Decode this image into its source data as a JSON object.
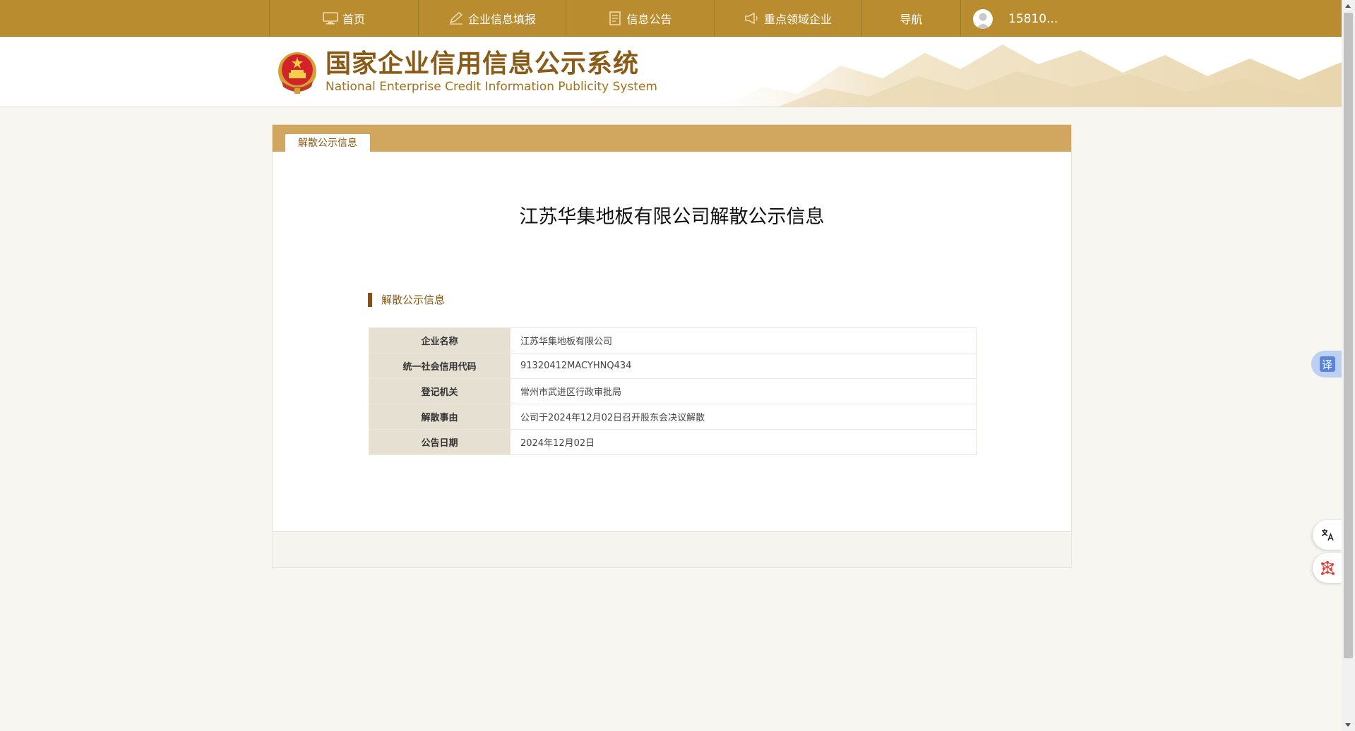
{
  "nav": {
    "items": [
      {
        "label": "首页",
        "icon": "monitor-icon"
      },
      {
        "label": "企业信息填报",
        "icon": "pen-icon"
      },
      {
        "label": "信息公告",
        "icon": "document-icon"
      },
      {
        "label": "重点领域企业",
        "icon": "megaphone-icon"
      },
      {
        "label": "导航",
        "icon": ""
      }
    ],
    "user": "15810..."
  },
  "header": {
    "title_cn": "国家企业信用信息公示系统",
    "title_en": "National Enterprise Credit Information Publicity System"
  },
  "panel": {
    "tab": "解散公示信息",
    "doc_title": "江苏华集地板有限公司解散公示信息",
    "section": "解散公示信息",
    "rows": [
      {
        "key": "企业名称",
        "value": "江苏华集地板有限公司"
      },
      {
        "key": "统一社会信用代码",
        "value": "91320412MACYHNQ434"
      },
      {
        "key": "登记机关",
        "value": "常州市武进区行政审批局"
      },
      {
        "key": "解散事由",
        "value": "公司于2024年12月02日召开股东会决议解散"
      },
      {
        "key": "公告日期",
        "value": "2024年12月02日"
      }
    ]
  },
  "widgets": {
    "translate_glyph": "译"
  },
  "colors": {
    "nav_bg": "#b88c2f",
    "panel_head": "#d1a75f",
    "accent_brown": "#8a5a17"
  }
}
